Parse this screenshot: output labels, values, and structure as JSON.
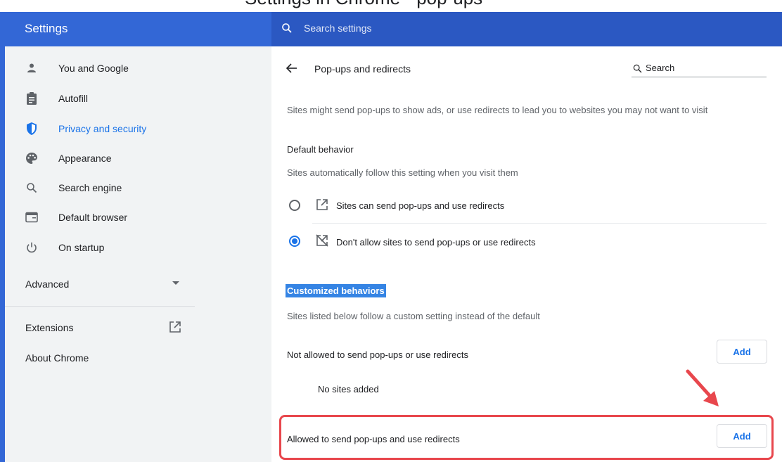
{
  "window": {
    "partial_title": "Settings in Chrome - pop-ups"
  },
  "header": {
    "title": "Settings",
    "search_placeholder": "Search settings"
  },
  "sidebar": {
    "items": [
      {
        "label": "You and Google",
        "icon": "person-icon"
      },
      {
        "label": "Autofill",
        "icon": "clipboard-icon"
      },
      {
        "label": "Privacy and security",
        "icon": "shield-icon",
        "active": true
      },
      {
        "label": "Appearance",
        "icon": "palette-icon"
      },
      {
        "label": "Search engine",
        "icon": "search-icon"
      },
      {
        "label": "Default browser",
        "icon": "browser-window-icon"
      },
      {
        "label": "On startup",
        "icon": "power-icon"
      }
    ],
    "advanced_label": "Advanced",
    "extensions_label": "Extensions",
    "about_label": "About Chrome"
  },
  "page": {
    "title": "Pop-ups and redirects",
    "search_placeholder": "Search",
    "description": "Sites might send pop-ups to show ads, or use redirects to lead you to websites you may not want to visit",
    "default_behavior": {
      "heading": "Default behavior",
      "subtitle": "Sites automatically follow this setting when you visit them",
      "options": [
        {
          "label": "Sites can send pop-ups and use redirects",
          "checked": false
        },
        {
          "label": "Don't allow sites to send pop-ups or use redirects",
          "checked": true
        }
      ]
    },
    "customized": {
      "heading": "Customized behaviors",
      "subtitle": "Sites listed below follow a custom setting instead of the default",
      "not_allowed_label": "Not allowed to send pop-ups or use redirects",
      "not_allowed_empty": "No sites added",
      "allowed_label": "Allowed to send pop-ups and use redirects",
      "add_label": "Add"
    }
  },
  "colors": {
    "header_blue": "#3367d6",
    "accent": "#1a73e8",
    "highlight_red": "#e8474d"
  }
}
